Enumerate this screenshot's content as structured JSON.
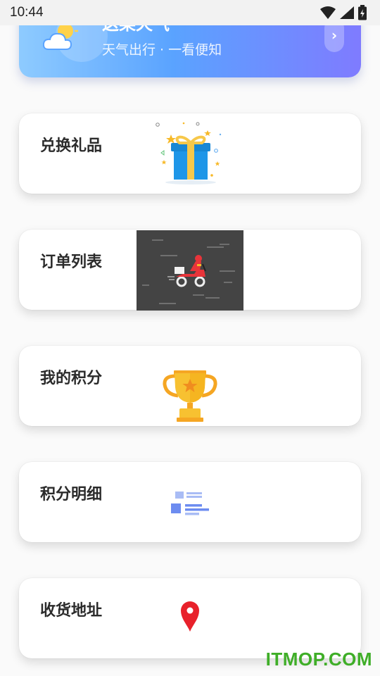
{
  "status_bar": {
    "time": "10:44",
    "icons": [
      "wifi-icon",
      "signal-icon",
      "battery-icon"
    ]
  },
  "weather": {
    "title": "这某天气",
    "subtitle": "天气出行 · 一看便知",
    "arrow": "›",
    "icon": "weather-sun-cloud-icon"
  },
  "menu": [
    {
      "label": "兑换礼品",
      "icon": "gift-icon"
    },
    {
      "label": "订单列表",
      "icon": "delivery-scooter-image"
    },
    {
      "label": "我的积分",
      "icon": "trophy-icon"
    },
    {
      "label": "积分明细",
      "icon": "list-detail-icon"
    },
    {
      "label": "收货地址",
      "icon": "location-pin-icon"
    }
  ],
  "watermark": "ITMOP.COM",
  "colors": {
    "banner_start": "#8ecbff",
    "banner_end": "#7f7bff",
    "gift_blue": "#1e96e8",
    "trophy_gold": "#f7b928",
    "pin_red": "#e8212b",
    "list_blue": "#6d8cf0",
    "watermark_green": "#3fae28"
  }
}
